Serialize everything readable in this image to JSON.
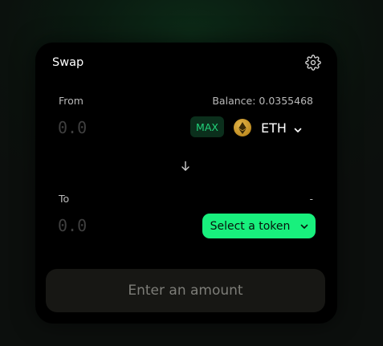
{
  "swap": {
    "title": "Swap",
    "from": {
      "label": "From",
      "balance": "Balance: 0.0355468",
      "amount_placeholder": "0.0",
      "max_label": "MAX",
      "token": "ETH"
    },
    "to": {
      "label": "To",
      "balance": "-",
      "amount_placeholder": "0.0",
      "select_label": "Select a token"
    },
    "submit_label": "Enter an amount"
  },
  "icons": {
    "settings": "gear-icon",
    "switch": "arrow-down-icon",
    "token": "eth-icon",
    "dropdown": "chevron-down-icon"
  },
  "colors": {
    "accent": "#18f07d",
    "max_text": "#22d27a",
    "max_bg": "#0b2f1c",
    "card_bg": "#000000",
    "eth_gold": "#c9952b"
  }
}
